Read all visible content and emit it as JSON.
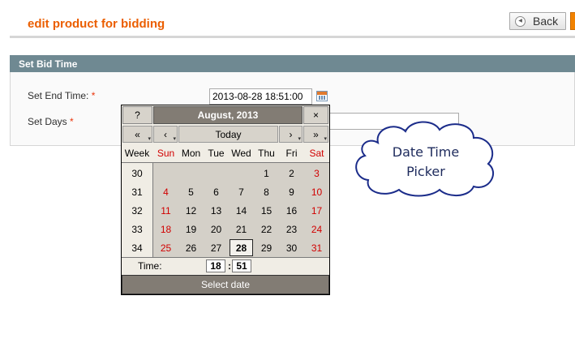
{
  "page": {
    "title": "edit product for bidding",
    "back_label": "Back"
  },
  "fieldset": {
    "title": "Set Bid Time",
    "end_time_label": "Set End Time:",
    "end_time_value": "2013-08-28 18:51:00",
    "days_label": "Set Days",
    "required_mark": "*",
    "days_value": ""
  },
  "calendar": {
    "help": "?",
    "month_label": "August, 2013",
    "close": "×",
    "nav": {
      "prev_year": "«",
      "prev_month": "‹",
      "today": "Today",
      "next_month": "›",
      "next_year": "»"
    },
    "weekdays": [
      "Week",
      "Sun",
      "Mon",
      "Tue",
      "Wed",
      "Thu",
      "Fri",
      "Sat"
    ],
    "weeks": [
      {
        "week": "30",
        "days": [
          "",
          "",
          "",
          "",
          "1",
          "2",
          "3"
        ]
      },
      {
        "week": "31",
        "days": [
          "4",
          "5",
          "6",
          "7",
          "8",
          "9",
          "10"
        ]
      },
      {
        "week": "32",
        "days": [
          "11",
          "12",
          "13",
          "14",
          "15",
          "16",
          "17"
        ]
      },
      {
        "week": "33",
        "days": [
          "18",
          "19",
          "20",
          "21",
          "22",
          "23",
          "24"
        ]
      },
      {
        "week": "34",
        "days": [
          "25",
          "26",
          "27",
          "28",
          "29",
          "30",
          "31"
        ]
      }
    ],
    "selected_day": "28",
    "time_label": "Time:",
    "hour": "18",
    "minute": "51",
    "select_label": "Select date"
  },
  "annotation": {
    "line1": "Date Time",
    "line2": "Picker"
  },
  "colors": {
    "title": "#eb5e00",
    "header_bar": "#6f8992",
    "calendar_dark": "#827c74",
    "weekend": "#d10000"
  }
}
